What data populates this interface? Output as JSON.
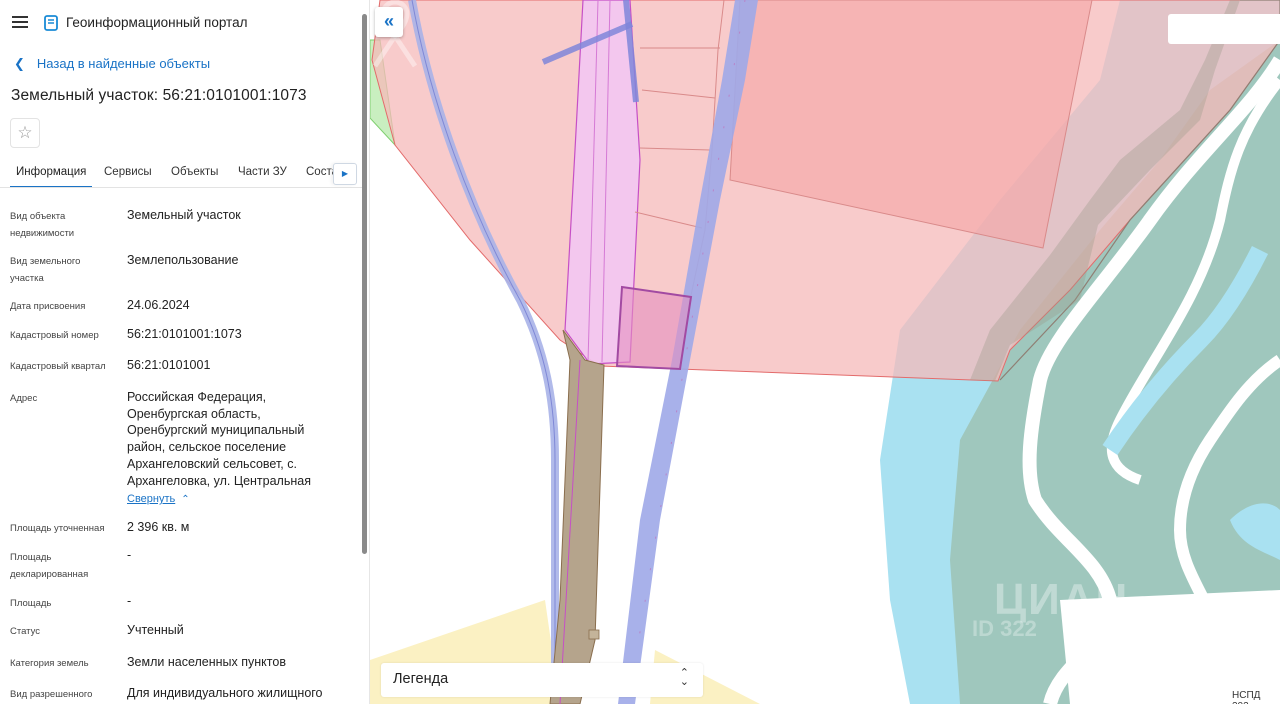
{
  "header": {
    "title": "Геоинформационный портал",
    "menu_icon": "hamburger-icon",
    "logo_icon": "portal-logo-icon"
  },
  "navigation": {
    "back_label": "Назад в найденные объекты"
  },
  "object": {
    "title": "Земельный участок: 56:21:0101001:1073"
  },
  "tabs": [
    {
      "label": "Информация",
      "active": true
    },
    {
      "label": "Сервисы",
      "active": false
    },
    {
      "label": "Объекты",
      "active": false
    },
    {
      "label": "Части ЗУ",
      "active": false
    },
    {
      "label": "Соста",
      "active": false
    }
  ],
  "properties": [
    {
      "label": "Вид объекта недвижимости",
      "value": "Земельный участок"
    },
    {
      "label": "Вид земельного участка",
      "value": "Землепользование"
    },
    {
      "label": "Дата присвоения",
      "value": "24.06.2024"
    },
    {
      "label": "Кадастровый номер",
      "value": "56:21:0101001:1073"
    },
    {
      "label": "Кадастровый квартал",
      "value": "56:21:0101001"
    },
    {
      "label": "Адрес",
      "value": "Российская Федерация, Оренбургская область, Оренбургский муниципальный район, сельское поселение Архангеловский сельсовет, с. Архангеловка, ул. Центральная"
    },
    {
      "label": "Площадь уточненная",
      "value": "2 396 кв. м"
    },
    {
      "label": "Площадь декларированная",
      "value": "-"
    },
    {
      "label": "Площадь",
      "value": "-"
    },
    {
      "label": "Статус",
      "value": "Учтенный"
    },
    {
      "label": "Категория земель",
      "value": "Земли населенных пунктов"
    },
    {
      "label": "Вид разрешенного",
      "value": "Для индивидуального жилищного"
    }
  ],
  "address_collapse_label": "Свернуть",
  "map": {
    "legend_label": "Легенда",
    "watermark_text": "ЦИАН",
    "watermark_sub": "ID 322",
    "attribution": "НСПД 202",
    "colors": {
      "parcel_fill": "#f5b5b5",
      "water": "#a8dff0",
      "green_zone": "#9fc9bf",
      "road": "#b0a48a",
      "selected_parcel": "#d98bb4",
      "link_blue": "#1a73c6"
    }
  }
}
